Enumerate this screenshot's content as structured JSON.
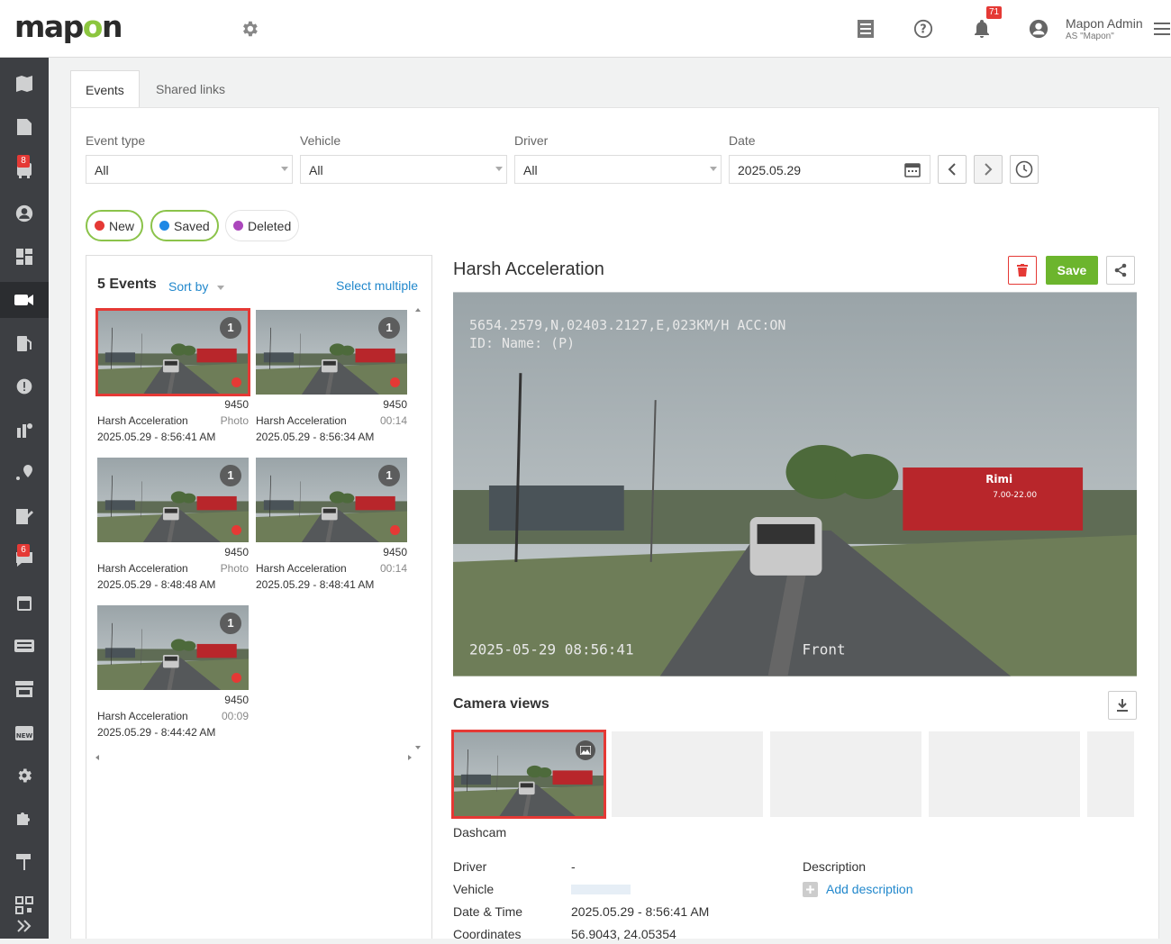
{
  "app": {
    "logo": "mapon"
  },
  "header": {
    "notifications_count": "71",
    "user_name": "Mapon Admin",
    "user_org": "AS \"Mapon\""
  },
  "sidebar": {
    "badges": {
      "routes": "8",
      "messages": "6"
    }
  },
  "tabs": [
    {
      "label": "Events",
      "active": true
    },
    {
      "label": "Shared links",
      "active": false
    }
  ],
  "filters": {
    "event_type": {
      "label": "Event type",
      "value": "All"
    },
    "vehicle": {
      "label": "Vehicle",
      "value": "All"
    },
    "driver": {
      "label": "Driver",
      "value": "All"
    },
    "date": {
      "label": "Date",
      "value": "2025.05.29"
    }
  },
  "status_filters": [
    {
      "label": "New",
      "color": "#e53935",
      "active": true
    },
    {
      "label": "Saved",
      "color": "#1e88e5",
      "active": true
    },
    {
      "label": "Deleted",
      "color": "#ab47bc",
      "active": false
    }
  ],
  "events_list": {
    "title": "5 Events",
    "sort_label": "Sort by",
    "select_multiple": "Select multiple",
    "items": [
      {
        "count": "1",
        "vehicle": "9450",
        "type": "Harsh Acceleration",
        "media": "Photo",
        "datetime": "2025.05.29 - 8:56:41 AM"
      },
      {
        "count": "1",
        "vehicle": "9450",
        "type": "Harsh Acceleration",
        "media": "00:14",
        "datetime": "2025.05.29 - 8:56:34 AM"
      },
      {
        "count": "1",
        "vehicle": "9450",
        "type": "Harsh Acceleration",
        "media": "Photo",
        "datetime": "2025.05.29 - 8:48:48 AM"
      },
      {
        "count": "1",
        "vehicle": "9450",
        "type": "Harsh Acceleration",
        "media": "00:14",
        "datetime": "2025.05.29 - 8:48:41 AM"
      },
      {
        "count": "1",
        "vehicle": "9450",
        "type": "Harsh Acceleration",
        "media": "00:09",
        "datetime": "2025.05.29 - 8:44:42 AM"
      }
    ]
  },
  "detail": {
    "title": "Harsh Acceleration",
    "save_label": "Save",
    "overlay_top_1": "5654.2579,N,02403.2127,E,023KM/H ACC:ON",
    "overlay_top_2": "ID: Name: (P)",
    "overlay_timestamp": "2025-05-29 08:56:41",
    "overlay_camera": "Front",
    "sign_text_1": "Rimi",
    "sign_text_2": "7.00-22.00",
    "camera_views_title": "Camera views",
    "camera_label": "Dashcam",
    "fields": {
      "driver_label": "Driver",
      "driver_value": "-",
      "vehicle_label": "Vehicle",
      "datetime_label": "Date & Time",
      "datetime_value": "2025.05.29 - 8:56:41 AM",
      "coords_label": "Coordinates",
      "coords_value": "56.9043, 24.05354",
      "description_label": "Description",
      "add_description": "Add description"
    }
  }
}
